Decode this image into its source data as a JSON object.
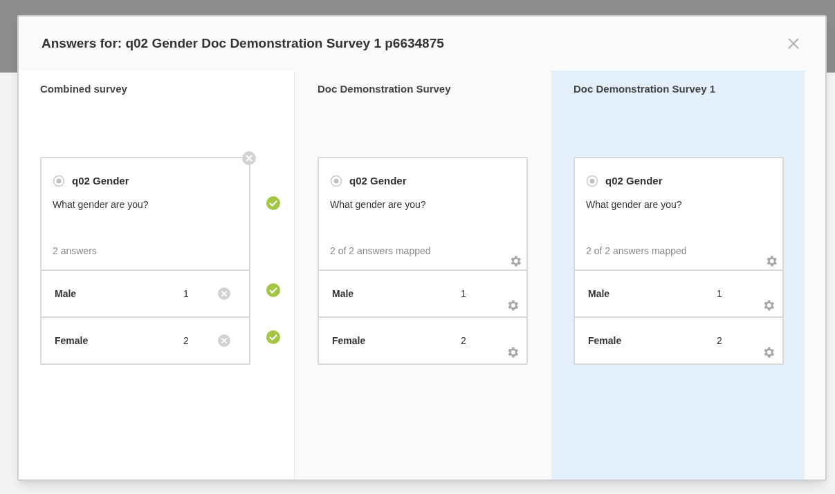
{
  "dialog": {
    "title": "Answers for: q02 Gender Doc Demonstration Survey 1 p6634875"
  },
  "columns": [
    {
      "kind": "combined",
      "title": "Combined survey",
      "selected": false,
      "question": {
        "name": "q02 Gender",
        "text": "What gender are you?",
        "summary": "2 answers",
        "matched": true
      },
      "answers": [
        {
          "label": "Male",
          "code": "1",
          "matched": true
        },
        {
          "label": "Female",
          "code": "2",
          "matched": true
        }
      ]
    },
    {
      "kind": "source",
      "title": "Doc Demonstration Survey",
      "selected": false,
      "question": {
        "name": "q02 Gender",
        "text": "What gender are you?",
        "summary": "2 of 2 answers mapped"
      },
      "answers": [
        {
          "label": "Male",
          "code": "1"
        },
        {
          "label": "Female",
          "code": "2"
        }
      ]
    },
    {
      "kind": "source",
      "title": "Doc Demonstration Survey 1",
      "selected": true,
      "question": {
        "name": "q02 Gender",
        "text": "What gender are you?",
        "summary": "2 of 2 answers mapped"
      },
      "answers": [
        {
          "label": "Male",
          "code": "1"
        },
        {
          "label": "Female",
          "code": "2"
        }
      ]
    }
  ]
}
